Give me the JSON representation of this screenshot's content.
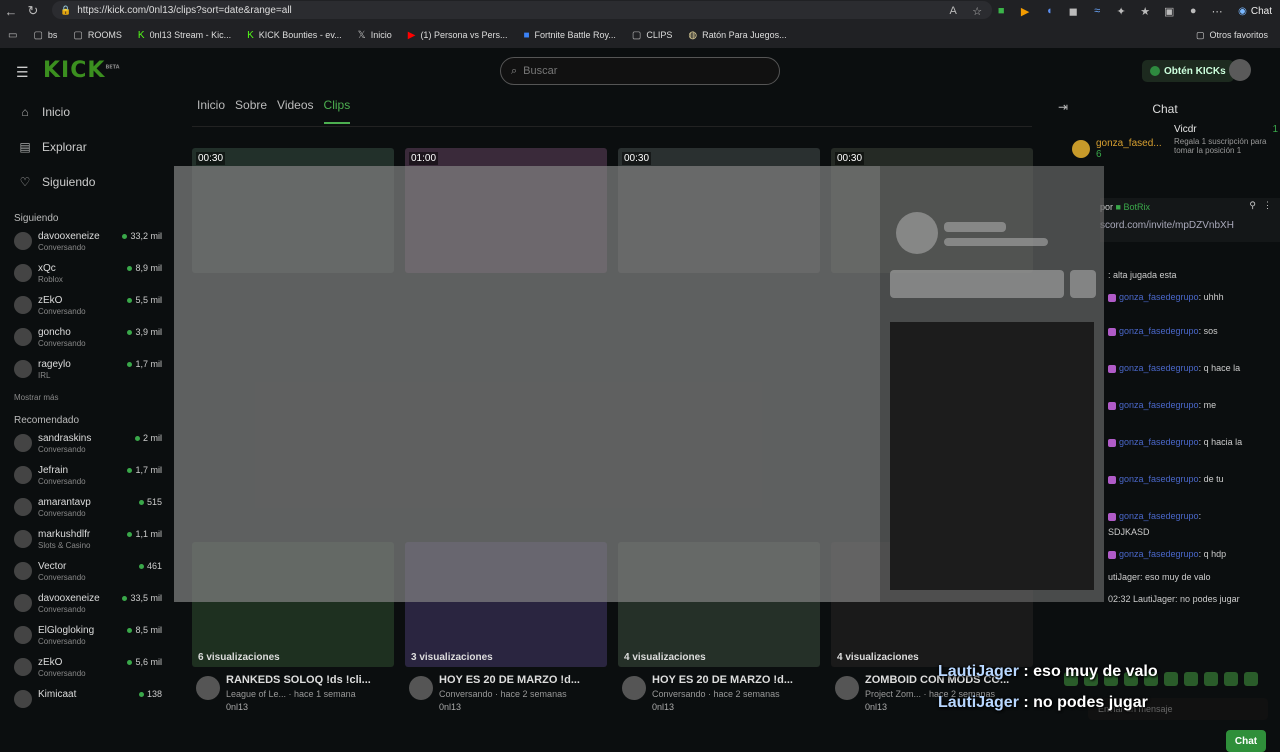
{
  "browser": {
    "url": "https://kick.com/0nl13/clips?sort=date&range=all",
    "chat_label": "Chat",
    "bookmarks": [
      "bs",
      "ROOMS",
      "0nl13 Stream - Kic...",
      "KICK Bounties - ev...",
      "Inicio",
      "(1) Persona vs Pers...",
      "Fortnite Battle Roy...",
      "CLIPS",
      "Ratón Para Juegos..."
    ],
    "bookmarks_right": "Otros favoritos"
  },
  "header": {
    "logo": "KICK",
    "logo_badge": "BETA",
    "search_placeholder": "Buscar",
    "get_kicks": "Obtén KICKs"
  },
  "sidebar": {
    "nav": [
      {
        "label": "Inicio",
        "icon": "home-icon"
      },
      {
        "label": "Explorar",
        "icon": "explore-icon"
      },
      {
        "label": "Siguiendo",
        "icon": "heart-icon"
      }
    ],
    "following_title": "Siguiendo",
    "following": [
      {
        "name": "davooxeneize",
        "category": "Conversando",
        "viewers": "33,2 mil"
      },
      {
        "name": "xQc",
        "category": "Roblox",
        "viewers": "8,9 mil"
      },
      {
        "name": "zEkO",
        "category": "Conversando",
        "viewers": "5,5 mil"
      },
      {
        "name": "goncho",
        "category": "Conversando",
        "viewers": "3,9 mil"
      },
      {
        "name": "rageylo",
        "category": "IRL",
        "viewers": "1,7 mil"
      }
    ],
    "show_more": "Mostrar más",
    "recommended_title": "Recomendado",
    "recommended": [
      {
        "name": "sandraskins",
        "category": "Conversando",
        "viewers": "2 mil"
      },
      {
        "name": "Jefrain",
        "category": "Conversando",
        "viewers": "1,7 mil"
      },
      {
        "name": "amarantavp",
        "category": "Conversando",
        "viewers": "515"
      },
      {
        "name": "markushdlfr",
        "category": "Slots & Casino",
        "viewers": "1,1 mil"
      },
      {
        "name": "Vector",
        "category": "Conversando",
        "viewers": "461"
      },
      {
        "name": "davooxeneize",
        "category": "Conversando",
        "viewers": "33,5 mil"
      },
      {
        "name": "ElGlogloking",
        "category": "Conversando",
        "viewers": "8,5 mil"
      },
      {
        "name": "zEkO",
        "category": "Conversando",
        "viewers": "5,6 mil"
      },
      {
        "name": "Kimicaat",
        "category": "",
        "viewers": "138"
      }
    ]
  },
  "tabs": [
    "Inicio",
    "Sobre",
    "Videos",
    "Clips"
  ],
  "clips_top": [
    "00:30",
    "01:00",
    "00:30",
    "00:30"
  ],
  "clips": [
    {
      "views": "6 visualizaciones",
      "title": "RANKEDS SOLOQ !ds !cli...",
      "sub": "League of Le... · hace 1 semana",
      "author": "0nl13"
    },
    {
      "views": "3 visualizaciones",
      "title": "HOY ES 20 DE MARZO !d...",
      "sub": "Conversando · hace 2 semanas",
      "author": "0nl13"
    },
    {
      "views": "4 visualizaciones",
      "title": "HOY ES 20 DE MARZO !d...",
      "sub": "Conversando · hace 2 semanas",
      "author": "0nl13"
    },
    {
      "views": "4 visualizaciones",
      "title": "ZOMBOID CON MODS CO...",
      "sub": "Project Zom... · hace 2 semanas",
      "author": "0nl13"
    }
  ],
  "chat": {
    "title": "Chat",
    "gift_user": "gonza_fased...",
    "gift_count": "6",
    "gift_user2": "Vicdr",
    "gift_count2": "1",
    "gift_note": "Regala 1 suscripción para tomar la posición 1",
    "pinned_by": "por",
    "pinned_bot": "BotRix",
    "pinned_link": "scord.com/invite/mpDZVnbXH",
    "messages": [
      {
        "user": "",
        "text": ": alta jugada esta"
      },
      {
        "user": "gonza_fasedegrupo",
        "text": ": uhhh"
      },
      {
        "user": "gonza_fasedegrupo",
        "text": ": sos"
      },
      {
        "user": "gonza_fasedegrupo",
        "text": ": q hace la"
      },
      {
        "user": "gonza_fasedegrupo",
        "text": ": me"
      },
      {
        "user": "gonza_fasedegrupo",
        "text": ": q hacia la"
      },
      {
        "user": "gonza_fasedegrupo",
        "text": ": de tu"
      },
      {
        "user": "gonza_fasedegrupo",
        "text": ":"
      },
      {
        "user": "",
        "text": "SDJKASD"
      },
      {
        "user": "gonza_fasedegrupo",
        "text": ": q hdp"
      },
      {
        "user": "",
        "text": "utiJager: eso muy de valo"
      },
      {
        "user": "",
        "text": "02:32 LautiJager: no podes jugar"
      }
    ],
    "input_placeholder": "Enviar un mensaje",
    "send": "Chat"
  },
  "overlay": {
    "line1_name": "LautiJager",
    "line1_text": " : eso muy de valo",
    "line2_name": "LautiJager",
    "line2_text": " : no podes jugar"
  }
}
